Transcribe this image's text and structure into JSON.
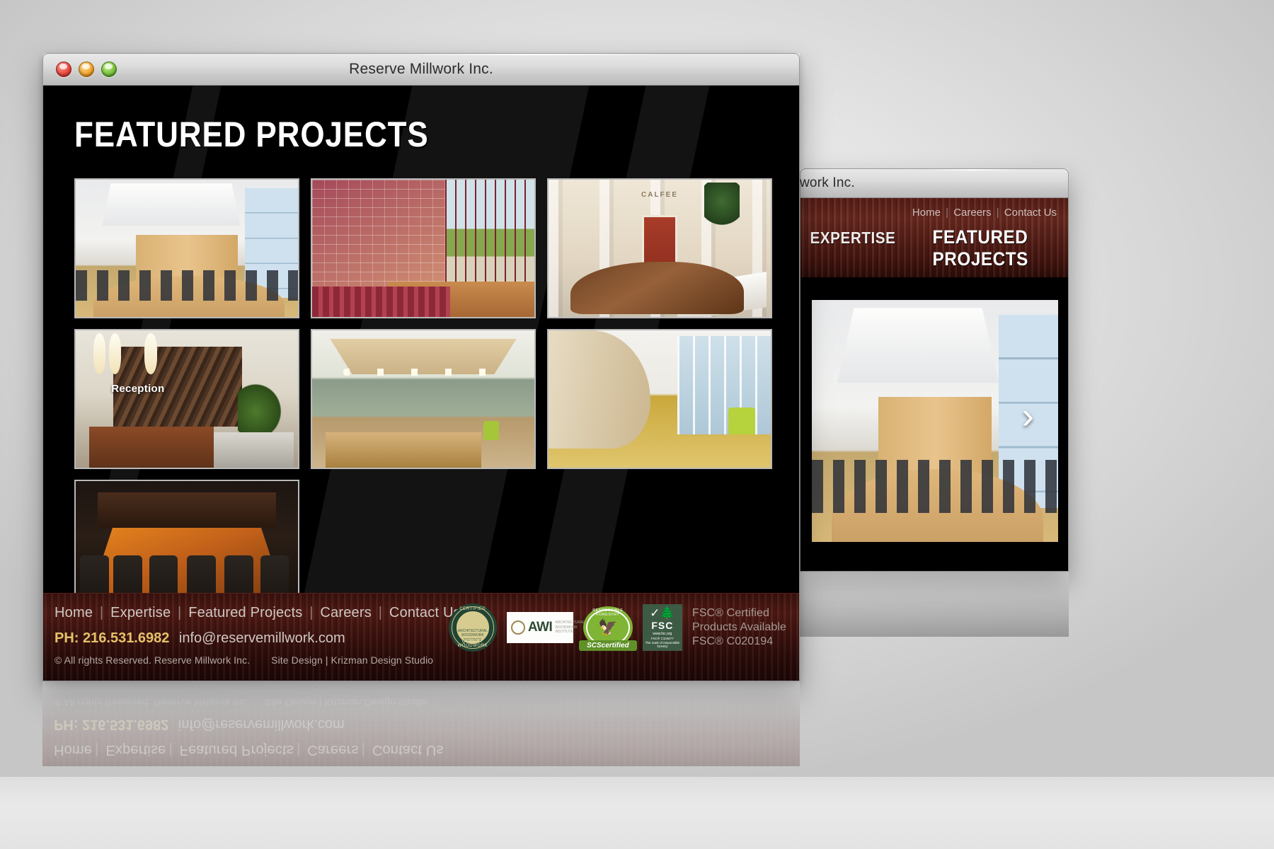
{
  "main_window": {
    "title": "Reserve Millwork Inc.",
    "traffic_lights": [
      "close",
      "minimize",
      "zoom"
    ],
    "page_title": "FEATURED PROJECTS",
    "gallery": {
      "rows": [
        [
          {
            "name": "boardroom-light-wood",
            "caption": ""
          },
          {
            "name": "auditorium-wood-grid-wall",
            "caption": ""
          },
          {
            "name": "calfee-lobby-walnut-desk",
            "caption": "CALFEE"
          }
        ],
        [
          {
            "name": "reception-textured-wood-wall",
            "caption": "Reception"
          },
          {
            "name": "office-reception-green-wall",
            "caption": ""
          },
          {
            "name": "curved-corridor-gold-carpet",
            "caption": ""
          }
        ],
        [
          {
            "name": "dark-conference-room-cherry-table",
            "caption": ""
          }
        ]
      ]
    },
    "footer": {
      "nav": [
        "Home",
        "Expertise",
        "Featured Projects",
        "Careers",
        "Contact Us"
      ],
      "separator": "|",
      "phone_label": "PH:",
      "phone": "216.531.6982",
      "email": "info@reservemillwork.com",
      "copyright": "© All rights Reserved. Reserve Millwork Inc.",
      "site_design": "Site Design | Krizman Design Studio",
      "badges": [
        {
          "name": "awi-quality-certification-seal",
          "top_text": "CERTIFIED",
          "bottom_text": "QUALITY WOODWORK",
          "center_text": "ARCHITECTURAL WOODWORK INSTITUTE"
        },
        {
          "name": "awi-logo",
          "acronym": "AWI",
          "sub1": "ARCHITECTURAL",
          "sub2": "WOODWORK",
          "sub3": "INSTITUTE"
        },
        {
          "name": "scs-certified-responsible-forestry-seal",
          "arc_text": "RESPONSIBLE FORESTRY",
          "ribbon": "SCScertified"
        },
        {
          "name": "fsc-certification-mark",
          "acronym": "FSC",
          "url": "www.fsc.org",
          "code": "FSC® C104677",
          "tagline": "The mark of responsible forestry"
        }
      ],
      "fsc_text": {
        "line1": "FSC® Certified",
        "line2": "Products Available",
        "line3": "FSC® C020194"
      }
    }
  },
  "back_window": {
    "title": "work Inc.",
    "top_nav": [
      "Home",
      "Careers",
      "Contact Us"
    ],
    "separator": "|",
    "main_menu": [
      "EXPERTISE",
      "FEATURED PROJECTS"
    ],
    "hero": {
      "name": "boardroom-light-wood-hero"
    },
    "next_arrow": "›"
  },
  "colors": {
    "accent_gold": "#e5c26a",
    "wood_dark_red": "#511a14",
    "page_black": "#000000",
    "desktop_gray": "#e4e4e4"
  }
}
